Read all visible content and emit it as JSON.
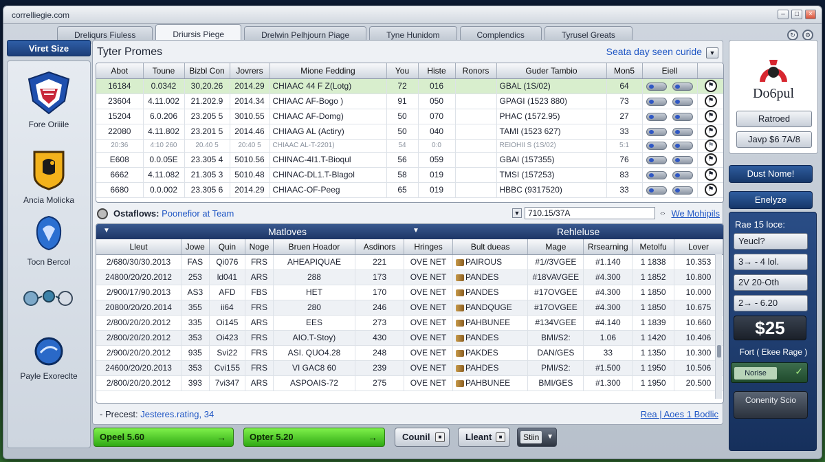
{
  "window": {
    "title": "correlliegie.com"
  },
  "tabs": [
    {
      "label": "Dreliqurs Fiuless"
    },
    {
      "label": "Driursis Piege"
    },
    {
      "label": "Drelwin Pelhjourn Piage"
    },
    {
      "label": "Tyne Hunidom"
    },
    {
      "label": "Complendics"
    },
    {
      "label": "Tyrusel Greats"
    }
  ],
  "left": {
    "header": "Viret Size",
    "teams": [
      {
        "name": "Fore Oriiile"
      },
      {
        "name": "Ancia Molicka"
      },
      {
        "name": "Tocn Bercol"
      },
      {
        "name": ""
      },
      {
        "name": "Payle Exoreclte"
      }
    ]
  },
  "main": {
    "title": "Tyter Promes",
    "link": "Seata day seen curide",
    "table1": {
      "headers": [
        "Abot",
        "Toune",
        "Bizbl Con",
        "Jovrers",
        "Mione Fedding",
        "You",
        "Histe",
        "Ronors",
        "Guder Tambio",
        "Mon5",
        "Eiell",
        ""
      ],
      "rows": [
        [
          "16184",
          "0.0342",
          "30,20.26",
          "2014.29",
          "CHIAAC 44 F Z(Lotg)",
          "72",
          "016",
          "",
          "GBAL (1S/02)",
          "64"
        ],
        [
          "23604",
          "4.11.002",
          "21.202.9",
          "2014.34",
          "CHIAAC AF-Bogo )",
          "91",
          "050",
          "",
          "GPAGI (1523 880)",
          "73"
        ],
        [
          "15204",
          "6.0.206",
          "23.205 5",
          "3010.55",
          "CHIAAC AF-Domg)",
          "50",
          "070",
          "",
          "PHAC (1572.95)",
          "27"
        ],
        [
          "22080",
          "4.11.802",
          "23.201 5",
          "2014.46",
          "CHIAAG AL (Actiry)",
          "50",
          "040",
          "",
          "TAMI (1523 627)",
          "33"
        ],
        [
          "20:36",
          "4:10 260",
          "20.40 5",
          "20:40 5",
          "CHIAAC AL-T-2201)",
          "54",
          "0:0",
          "",
          "REIOHII S (1S/02)",
          "5:1"
        ],
        [
          "E608",
          "0.0.05E",
          "23.305 4",
          "5010.56",
          "CHINAC-4I1.T-Bioqul",
          "56",
          "059",
          "",
          "GBAI (157355)",
          "76"
        ],
        [
          "6662",
          "4.11.082",
          "21.305 3",
          "5010.48",
          "CHINAC-DL1.T-Blagol",
          "58",
          "019",
          "",
          "TMSI (157253)",
          "83"
        ],
        [
          "6680",
          "0.0.002",
          "23.305 6",
          "2014.29",
          "CHIAAC-OF-Peeg",
          "65",
          "019",
          "",
          "HBBC (9317520)",
          "33"
        ]
      ]
    },
    "status": {
      "label": "Ostaflows:",
      "value": "Poonefior at Team",
      "filter_value": "710.15/37A",
      "more_link": "We Mohipils"
    },
    "section": {
      "left": "Matloves",
      "right": "Rehleluse"
    },
    "table2": {
      "headers": [
        "Lleut",
        "Jowe",
        "Quin",
        "Noge",
        "Bruen Hoador",
        "Asdinors",
        "Hringes",
        "Bult dueas",
        "Mage",
        "Rrsearning",
        "Metolfu",
        "Lover"
      ],
      "rows": [
        [
          "2/680/30/30.2013",
          "FAS",
          "Qi076",
          "FRS",
          "AHEAPIQUAE",
          "221",
          "OVE NET",
          "PAIROUS",
          "#1//3VGEE",
          "#1.140",
          "1 1838",
          "10.353"
        ],
        [
          "24800/20/20.2012",
          "253",
          "ld041",
          "ARS",
          "288",
          "173",
          "OVE NET",
          "PANDES",
          "#18VAVGEE",
          "#4.300",
          "1 1852",
          "10.800"
        ],
        [
          "2/900/17/90.2013",
          "AS3",
          "AFD",
          "FBS",
          "HET",
          "170",
          "OVE NET",
          "PANDES",
          "#17OVGEE",
          "#4.300",
          "1 1850",
          "10.000"
        ],
        [
          "20800/20/20.2014",
          "355",
          "ii64",
          "FRS",
          "280",
          "246",
          "OVE NET",
          "PANDQUGE",
          "#17OVGEE",
          "#4.300",
          "1 1850",
          "10.675"
        ],
        [
          "2/800/20/20.2012",
          "335",
          "Oi145",
          "ARS",
          "EES",
          "273",
          "OVE NET",
          "PAHBUNEE",
          "#134VGEE",
          "#4.140",
          "1 1839",
          "10.660"
        ],
        [
          "2/800/20/20.2012",
          "353",
          "Oi423",
          "FRS",
          "AIO.T-Stoy)",
          "430",
          "OVE NET",
          "PANDES",
          "BMI/S2:",
          "1.06",
          "1 1420",
          "10.406"
        ],
        [
          "2/900/20/20.2012",
          "935",
          "Svi22",
          "FRS",
          "ASI. QUO4.28",
          "248",
          "OVE NET",
          "PAKDES",
          "DAN/GES",
          "33",
          "1 1350",
          "10.300"
        ],
        [
          "24600/20/20.2013",
          "353",
          "Cvi155",
          "FRS",
          "VI GAC8 60",
          "239",
          "OVE NET",
          "PAHDES",
          "PMI/S2:",
          "#1.500",
          "1 1950",
          "10.506"
        ],
        [
          "2/800/20/20.2012",
          "393",
          "7vi347",
          "ARS",
          "ASPOAIS-72",
          "275",
          "OVE NET",
          "PAHBUNEE",
          "BMI/GES",
          "#1.300",
          "1 1950",
          "20.500"
        ]
      ]
    },
    "footer": {
      "label": "- Precest:",
      "value": "Jesteres.rating, 34",
      "link": "Rea | Aoes 1 Bodlic"
    }
  },
  "bottom": {
    "green1": "Opeel 5.60",
    "green2": "Opter 5.20",
    "btn1": "Counil",
    "btn2": "Lleant",
    "dark": "Stiin"
  },
  "right": {
    "logo_text": "Do6pul",
    "btn_top": "Ratroed",
    "btn_bottom": "Javp $6 7A/8",
    "blue1": "Dust Nome!",
    "blue2": "Enelyze",
    "panel_title": "Rae 15 loce:",
    "rows": [
      "Yeucl?",
      "3→ - 4 lol.",
      "2V  20-Oth",
      "2→ - 6.20"
    ],
    "price": "$25",
    "fort_label": "Fort ( Ekee Rage )",
    "toggle_label": "Norise",
    "conn": "Conenity Scio"
  }
}
